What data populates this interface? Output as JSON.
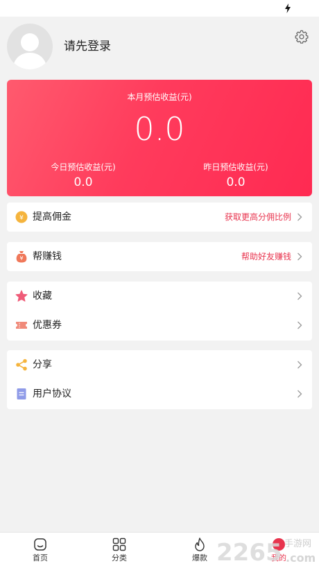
{
  "profile": {
    "login_prompt": "请先登录"
  },
  "earnings": {
    "month_label": "本月预估收益(元)",
    "month_value": "0.0",
    "today_label": "今日预估收益(元)",
    "today_value": "0.0",
    "yesterday_label": "昨日预估收益(元)",
    "yesterday_value": "0.0",
    "gradient_start": "#ff5a6e",
    "gradient_end": "#ff2a52"
  },
  "menu": {
    "commission": {
      "label": "提高佣金",
      "action_text": "获取更高分佣比例",
      "icon": "coin-icon"
    },
    "help_earn": {
      "label": "帮赚钱",
      "action_text": "帮助好友赚钱",
      "icon": "money-bag-icon"
    },
    "favorites": {
      "label": "收藏",
      "icon": "star-icon"
    },
    "coupons": {
      "label": "优惠券",
      "icon": "ticket-icon"
    },
    "share": {
      "label": "分享",
      "icon": "share-icon"
    },
    "agreement": {
      "label": "用户协议",
      "icon": "document-icon"
    }
  },
  "tabs": [
    {
      "label": "首页",
      "icon": "home-icon"
    },
    {
      "label": "分类",
      "icon": "grid-icon"
    },
    {
      "label": "爆款",
      "icon": "flame-icon"
    },
    {
      "label": "我的",
      "icon": "profile-icon",
      "active": true
    }
  ],
  "watermark": {
    "number": "2265",
    "site": "手游网",
    "domain": ".com"
  },
  "colors": {
    "accent": "#e8344e",
    "background": "#f2f2f2"
  }
}
